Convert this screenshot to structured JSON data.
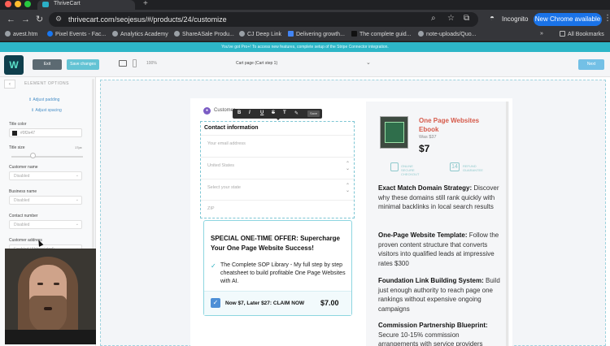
{
  "browser": {
    "tab_title": "ThriveCart",
    "url": "thrivecart.com/seojesus/#/products/24/customize",
    "incognito_label": "Incognito",
    "update_label": "New Chrome available",
    "bookmarks": [
      {
        "label": "avest.htm"
      },
      {
        "label": "Pixel Events - Fac..."
      },
      {
        "label": "Analytics Academy"
      },
      {
        "label": "ShareASale Produ..."
      },
      {
        "label": "CJ Deep Link"
      },
      {
        "label": "Delivering growth..."
      },
      {
        "label": "The complete guid..."
      },
      {
        "label": "note-uploads/Quo..."
      }
    ],
    "all_bookmarks_label": "All Bookmarks"
  },
  "app": {
    "promo_text": "You've got Pro+! To access new features, complete setup of the Stripe Connector integration.",
    "exit_label": "Exit",
    "save_label": "Save changes",
    "zoom": "100%",
    "page_select": "Cart page (Cart step 1)",
    "next_label": "Next"
  },
  "left_panel": {
    "title": "ELEMENT OPTIONS",
    "adjust_padding": "Adjust padding",
    "adjust_spacing": "Adjust spacing",
    "title_color_label": "Title color",
    "title_color_value": "#0f2e47",
    "title_size_label": "Title size",
    "title_size_value": "17px",
    "fields": [
      {
        "label": "Customer name",
        "value": "Disabled"
      },
      {
        "label": "Business name",
        "value": "Disabled"
      },
      {
        "label": "Contact number",
        "value": "Disabled"
      },
      {
        "label": "Customer address",
        "value": "Enabled (Abbreviated)"
      }
    ]
  },
  "preview": {
    "customer_label": "Customer",
    "format_toolbar": [
      "B",
      "I",
      "U",
      "S",
      "T",
      "✎"
    ],
    "format_save": "Save",
    "form_title": "Contact information",
    "email_placeholder": "Your email address",
    "country": "United States",
    "state_placeholder": "Select your state",
    "zip_placeholder": "ZIP",
    "offer_title": "SPECIAL ONE-TIME OFFER: Supercharge Your One Page Website Success!",
    "offer_desc": "The Complete SOP Library - My full step by step cheatsheet to build profitable One Page Websites with AI.",
    "offer_cta": "Now $7, Later $27: CLAIM NOW",
    "offer_price": "$7.00"
  },
  "summary": {
    "product_title": "One Page Websites Ebook",
    "was": "Was $37",
    "price": "$7",
    "badge_secure": "ONLINE SECURE CHECKOUT",
    "badge_days_num": "14",
    "badge_days": "REFUND GUARANTEE",
    "features": [
      {
        "title": "Exact Match Domain Strategy:",
        "text": "Discover why these domains still rank quickly with minimal backlinks in local search results"
      },
      {
        "title": "One-Page Website Template:",
        "text": "Follow the proven content structure that converts visitors into qualified leads at impressive rates $300"
      },
      {
        "title": "Foundation Link Building System:",
        "text": "Build just enough authority to reach page one rankings without expensive ongoing campaigns"
      },
      {
        "title": "Commission Partnership Blueprint:",
        "text": "Secure 10-15% commission arrangements with service providers"
      }
    ]
  },
  "colors": {
    "accent": "#2db6c7",
    "promo": "#2db6c7",
    "product_title": "#d65a4a",
    "checkbox": "#4d8fd6"
  }
}
